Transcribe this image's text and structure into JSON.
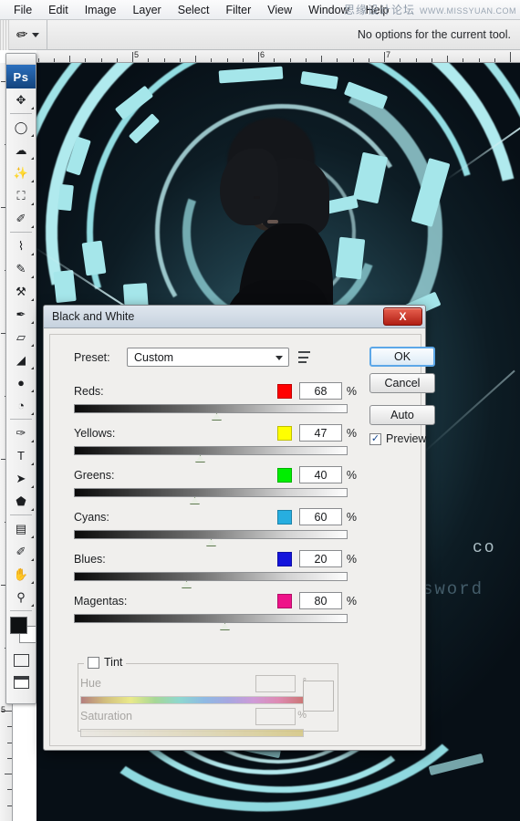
{
  "menubar": {
    "items": [
      "File",
      "Edit",
      "Image",
      "Layer",
      "Select",
      "Filter",
      "View",
      "Window",
      "Help"
    ],
    "watermark_cn": "思缘设计论坛",
    "watermark_url": "WWW.MISSYUAN.COM"
  },
  "optionsbar": {
    "tool_icon": "eyedropper-icon",
    "dropdown_icon": "chevron-down-icon",
    "message": "No options for the current tool."
  },
  "toolbox": {
    "logo": "Ps",
    "tools": [
      {
        "name": "move-tool",
        "glyph": "✥"
      },
      {
        "name": "elliptical-marquee-tool",
        "glyph": "◯"
      },
      {
        "name": "lasso-tool",
        "glyph": "☁"
      },
      {
        "name": "magic-wand-tool",
        "glyph": "✨"
      },
      {
        "name": "crop-tool",
        "glyph": "⛶"
      },
      {
        "name": "eyedropper-tool",
        "glyph": "✐"
      },
      {
        "name": "healing-brush-tool",
        "glyph": "⌇"
      },
      {
        "name": "brush-tool",
        "glyph": "✎"
      },
      {
        "name": "clone-stamp-tool",
        "glyph": "⚒"
      },
      {
        "name": "history-brush-tool",
        "glyph": "✒"
      },
      {
        "name": "eraser-tool",
        "glyph": "▱"
      },
      {
        "name": "paint-bucket-tool",
        "glyph": "◢"
      },
      {
        "name": "gradient-blur-tool",
        "glyph": "●"
      },
      {
        "name": "dodge-tool",
        "glyph": "◔"
      },
      {
        "name": "pen-tool",
        "glyph": "✑"
      },
      {
        "name": "type-tool",
        "glyph": "T"
      },
      {
        "name": "path-selection-tool",
        "glyph": "➤"
      },
      {
        "name": "shape-tool",
        "glyph": "⬟"
      },
      {
        "name": "notes-tool",
        "glyph": "▤"
      },
      {
        "name": "eyedropper-tool-2",
        "glyph": "✐"
      },
      {
        "name": "hand-tool",
        "glyph": "✋"
      },
      {
        "name": "zoom-tool",
        "glyph": "⚲"
      }
    ],
    "foreground_color": "#0f1113",
    "background_color": "#ffffff",
    "quickmask_icon": "quick-mask-icon",
    "swap_icon": "swap-colors-icon",
    "screenmode_icon": "screen-mode-icon"
  },
  "rulers": {
    "unit": "inches",
    "top_labels": [
      "5",
      "6",
      "7"
    ],
    "left_labels": [
      "5"
    ]
  },
  "canvas": {
    "hud_text_1": "co",
    "hud_text_2": "sword",
    "accent_color": "#a5e6ea",
    "background_color": "#0d1c24"
  },
  "dialog": {
    "title": "Black and White",
    "close_label": "X",
    "close_icon": "close-icon",
    "preset": {
      "label": "Preset:",
      "value": "Custom",
      "placeholder": "Custom",
      "arrow_icon": "chevron-down-icon",
      "menu_icon": "preset-options-icon"
    },
    "channels": [
      {
        "name": "Reds:",
        "value": "68",
        "unit": "%",
        "swatch": "#ff0000",
        "thumb_pct": 52
      },
      {
        "name": "Yellows:",
        "value": "47",
        "unit": "%",
        "swatch": "#ffff00",
        "thumb_pct": 46
      },
      {
        "name": "Greens:",
        "value": "40",
        "unit": "%",
        "swatch": "#00ee00",
        "thumb_pct": 44
      },
      {
        "name": "Cyans:",
        "value": "60",
        "unit": "%",
        "swatch": "#27aee0",
        "thumb_pct": 50
      },
      {
        "name": "Blues:",
        "value": "20",
        "unit": "%",
        "swatch": "#1414dc",
        "thumb_pct": 41
      },
      {
        "name": "Magentas:",
        "value": "80",
        "unit": "%",
        "swatch": "#ee1289",
        "thumb_pct": 55
      }
    ],
    "buttons": {
      "ok": "OK",
      "cancel": "Cancel",
      "auto": "Auto"
    },
    "preview": {
      "label": "Preview",
      "checked": true,
      "check_glyph": "✓"
    },
    "tint": {
      "label": "Tint",
      "checked": false,
      "hue_label": "Hue",
      "hue_value": "",
      "hue_unit": "°",
      "saturation_label": "Saturation",
      "saturation_value": "",
      "saturation_unit": "%"
    }
  }
}
